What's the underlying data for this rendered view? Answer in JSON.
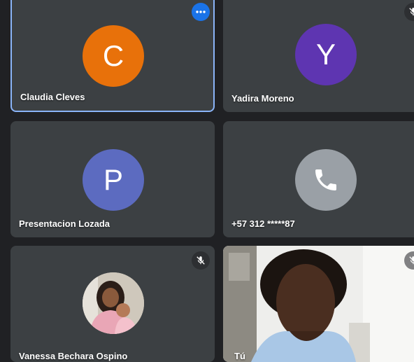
{
  "participants": [
    {
      "name": "Claudia Cleves",
      "initial": "C",
      "avatar_color": "#e8710a",
      "active": true,
      "more_menu": true
    },
    {
      "name": "Yadira Moreno",
      "initial": "Y",
      "avatar_color": "#5e35b1",
      "muted": true
    },
    {
      "name": "Presentacion Lozada",
      "initial": "P",
      "avatar_color": "#5c6bc0"
    },
    {
      "name": "+57 312 *****87",
      "avatar_icon": "phone-icon",
      "avatar_color": "#9aa0a6"
    },
    {
      "name": "Vanessa Bechara Ospino",
      "avatar_icon": "profile-photo",
      "muted": true
    },
    {
      "name": "Tú",
      "video": "camera-feed",
      "muted": true
    }
  ],
  "colors": {
    "background": "#202124",
    "tile": "#3c4043",
    "active_border": "#8ab4f8",
    "accent": "#1a73e8"
  }
}
